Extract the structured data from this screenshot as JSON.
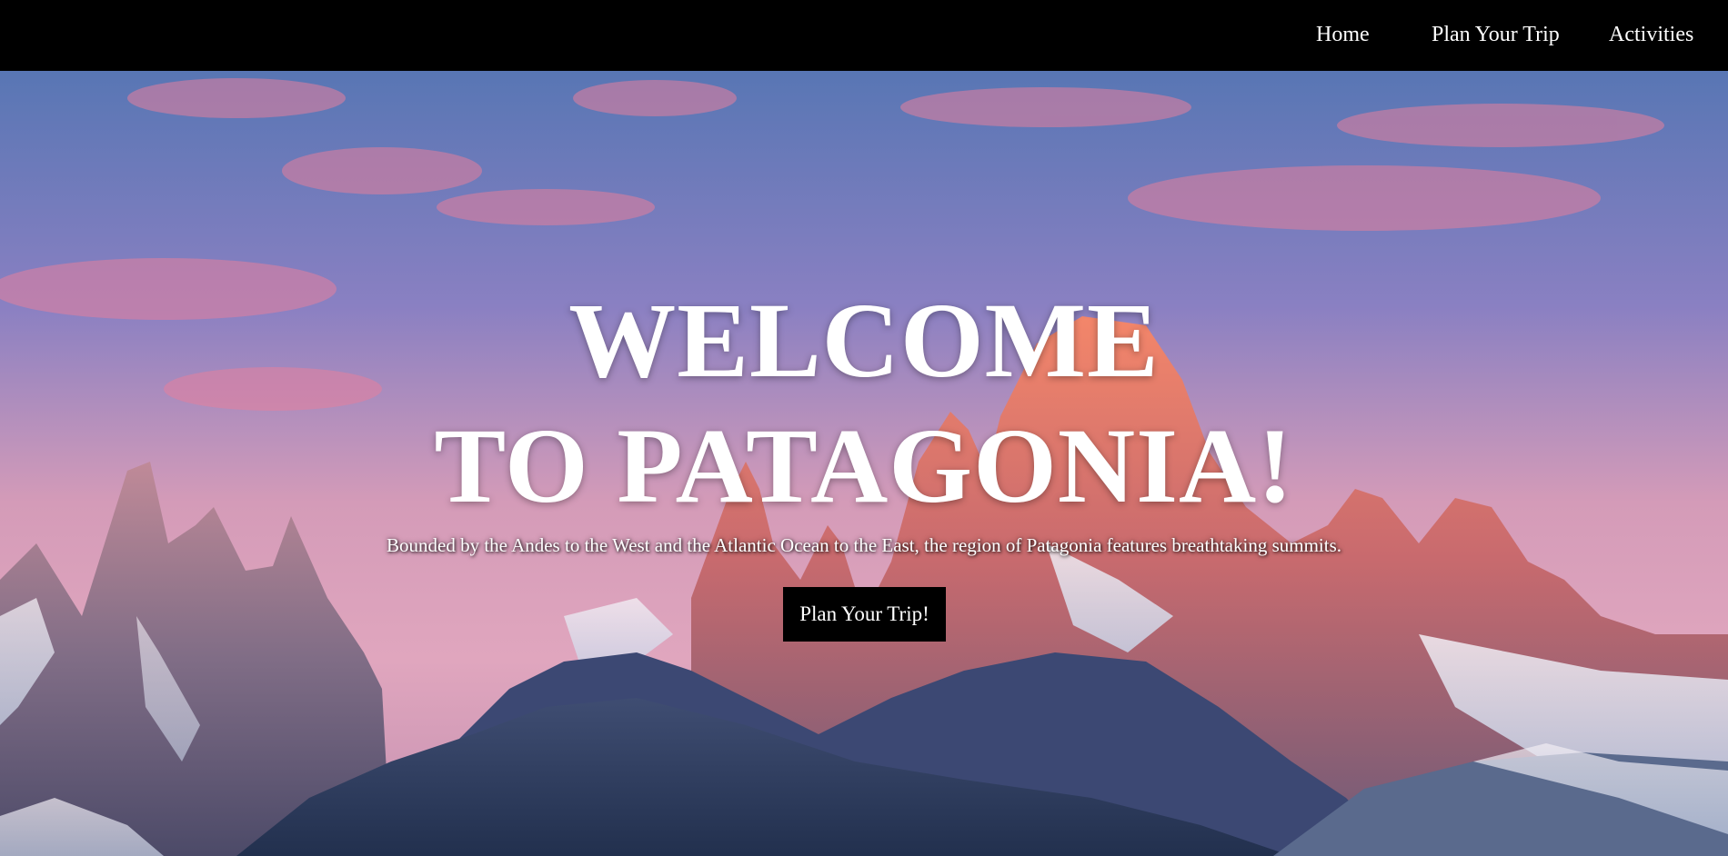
{
  "nav": {
    "items": [
      {
        "label": "Home"
      },
      {
        "label": "Plan Your Trip"
      },
      {
        "label": "Activities"
      }
    ]
  },
  "hero": {
    "title_line1": "WELCOME",
    "title_line2": "TO PATAGONIA!",
    "subtitle": "Bounded by the Andes to the West and the Atlantic Ocean to the East, the region of Patagonia features breathtaking summits.",
    "button_label": "Plan Your Trip!",
    "background_image": "patagonia-mountain-sunset-photo"
  },
  "colors": {
    "navbar_bg": "#000000",
    "nav_text": "#ffffff",
    "button_bg": "#000000",
    "button_text": "#ffffff",
    "title_text": "#ffffff"
  }
}
